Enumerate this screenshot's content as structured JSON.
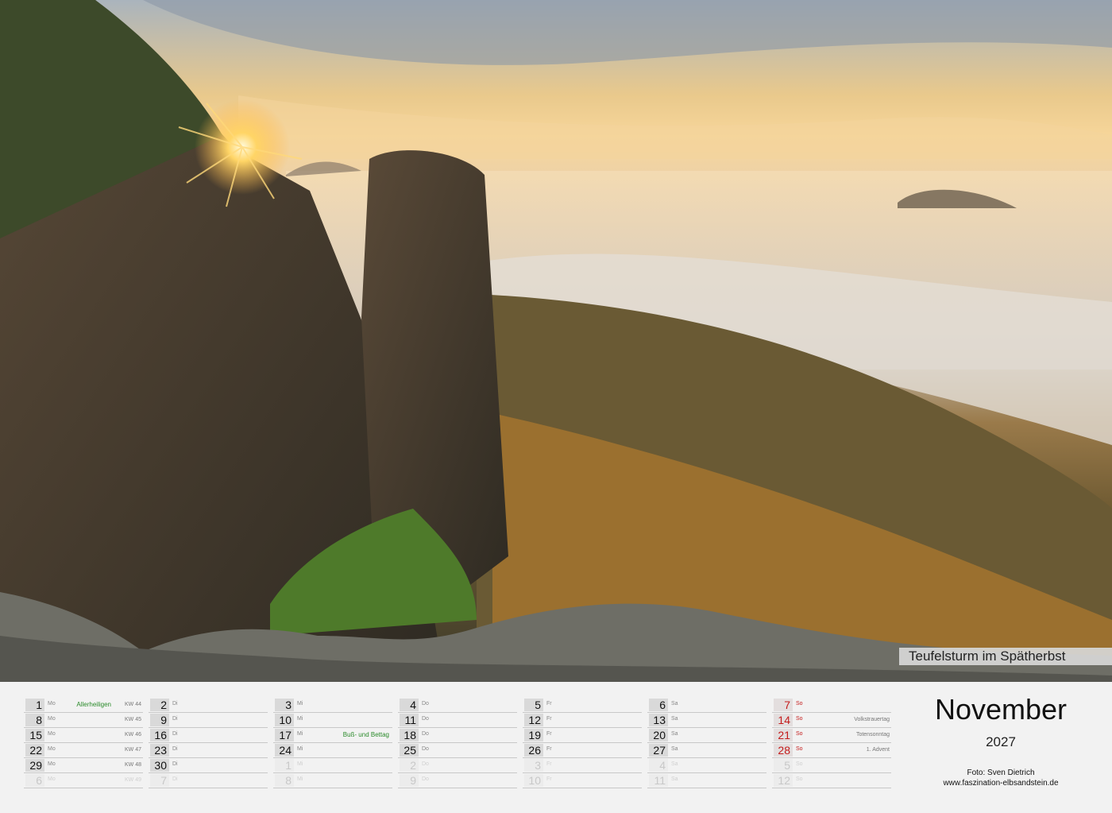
{
  "caption": "Teufelsturm im Spätherbst",
  "month": "November",
  "year": "2027",
  "credit_photo": "Foto: Sven Dietrich",
  "credit_url": "www.faszination-elbsandstein.de",
  "weeks": [
    {
      "days": [
        {
          "d": "1",
          "dn": "Mo",
          "ev": "Allerheiligen",
          "kw": "KW 44"
        },
        {
          "d": "8",
          "dn": "Mo",
          "kw": "KW 45"
        },
        {
          "d": "15",
          "dn": "Mo",
          "kw": "KW 46"
        },
        {
          "d": "22",
          "dn": "Mo",
          "kw": "KW 47"
        },
        {
          "d": "29",
          "dn": "Mo",
          "kw": "KW 48"
        },
        {
          "d": "6",
          "dn": "Mo",
          "kw": "KW 49",
          "faded": true
        }
      ]
    },
    {
      "days": [
        {
          "d": "2",
          "dn": "Di"
        },
        {
          "d": "9",
          "dn": "Di"
        },
        {
          "d": "16",
          "dn": "Di"
        },
        {
          "d": "23",
          "dn": "Di"
        },
        {
          "d": "30",
          "dn": "Di"
        },
        {
          "d": "7",
          "dn": "Di",
          "faded": true
        }
      ]
    },
    {
      "days": [
        {
          "d": "3",
          "dn": "Mi"
        },
        {
          "d": "10",
          "dn": "Mi"
        },
        {
          "d": "17",
          "dn": "Mi",
          "ev": "Buß- und Bettag"
        },
        {
          "d": "24",
          "dn": "Mi"
        },
        {
          "d": "1",
          "dn": "Mi",
          "faded": true
        },
        {
          "d": "8",
          "dn": "Mi",
          "faded": true
        }
      ]
    },
    {
      "days": [
        {
          "d": "4",
          "dn": "Do"
        },
        {
          "d": "11",
          "dn": "Do"
        },
        {
          "d": "18",
          "dn": "Do"
        },
        {
          "d": "25",
          "dn": "Do"
        },
        {
          "d": "2",
          "dn": "Do",
          "faded": true
        },
        {
          "d": "9",
          "dn": "Do",
          "faded": true
        }
      ]
    },
    {
      "days": [
        {
          "d": "5",
          "dn": "Fr"
        },
        {
          "d": "12",
          "dn": "Fr"
        },
        {
          "d": "19",
          "dn": "Fr"
        },
        {
          "d": "26",
          "dn": "Fr"
        },
        {
          "d": "3",
          "dn": "Fr",
          "faded": true
        },
        {
          "d": "10",
          "dn": "Fr",
          "faded": true
        }
      ]
    },
    {
      "days": [
        {
          "d": "6",
          "dn": "Sa"
        },
        {
          "d": "13",
          "dn": "Sa"
        },
        {
          "d": "20",
          "dn": "Sa"
        },
        {
          "d": "27",
          "dn": "Sa"
        },
        {
          "d": "4",
          "dn": "Sa",
          "faded": true
        },
        {
          "d": "11",
          "dn": "Sa",
          "faded": true
        }
      ]
    },
    {
      "days": [
        {
          "d": "7",
          "dn": "So",
          "sun": true
        },
        {
          "d": "14",
          "dn": "So",
          "sun": true,
          "hol": "Volkstrauertag"
        },
        {
          "d": "21",
          "dn": "So",
          "sun": true,
          "hol": "Totensonntag"
        },
        {
          "d": "28",
          "dn": "So",
          "sun": true,
          "hol": "1. Advent"
        },
        {
          "d": "5",
          "dn": "So",
          "faded": true
        },
        {
          "d": "12",
          "dn": "So",
          "faded": true
        }
      ]
    }
  ]
}
